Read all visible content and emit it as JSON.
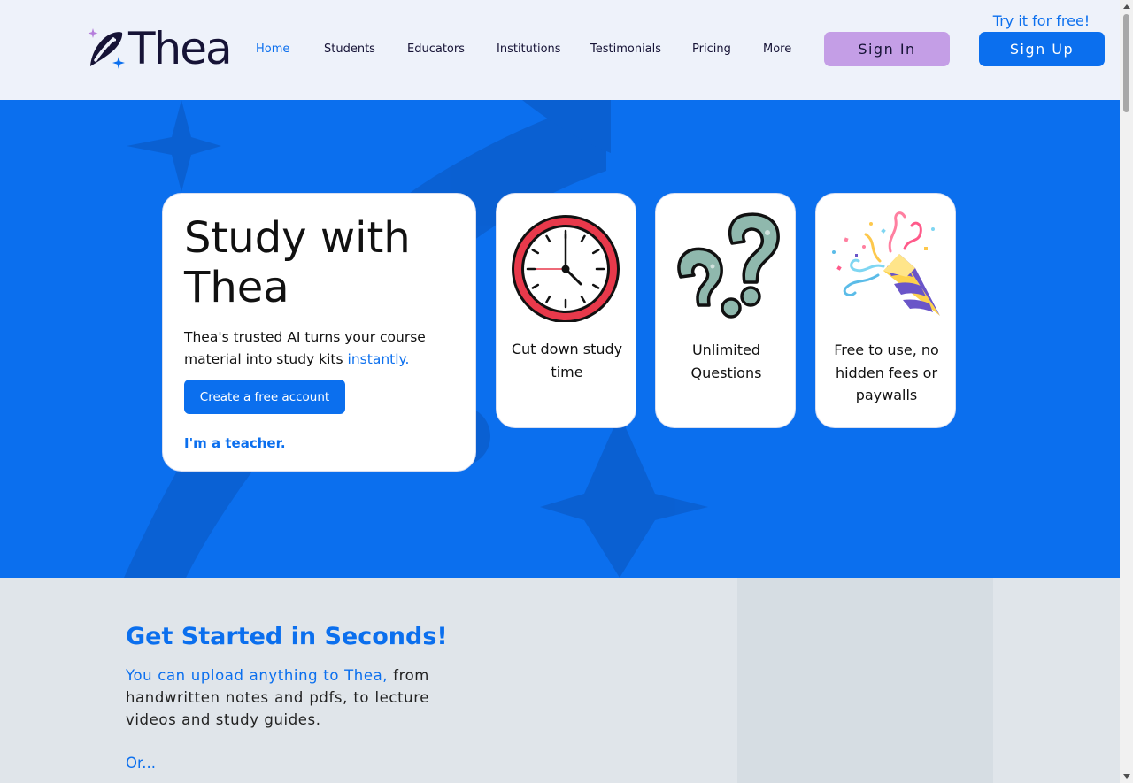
{
  "header": {
    "logo_text": "Thea",
    "nav": [
      {
        "label": "Home",
        "active": true
      },
      {
        "label": "Students",
        "active": false
      },
      {
        "label": "Educators",
        "active": false
      },
      {
        "label": "Institutions",
        "active": false
      },
      {
        "label": "Testimonials",
        "active": false
      },
      {
        "label": "Pricing",
        "active": false
      },
      {
        "label": "More",
        "active": false
      }
    ],
    "sign_in_label": "Sign In",
    "try_free_label": "Try it for free!",
    "sign_up_label": "Sign Up"
  },
  "hero": {
    "title_line1": "Study with",
    "title_line2": "Thea",
    "description": "Thea's trusted AI turns your course material into study kits",
    "description_highlight": "instantly.",
    "create_account_label": "Create a free account",
    "teacher_link_label": "I'm a teacher.",
    "features": [
      {
        "icon": "clock-icon",
        "label": "Cut down study time"
      },
      {
        "icon": "question-marks-icon",
        "label": "Unlimited Questions"
      },
      {
        "icon": "party-popper-icon",
        "label": "Free to use, no hidden fees or paywalls"
      }
    ]
  },
  "get_started": {
    "title": "Get Started in Seconds!",
    "desc_highlight": "You can upload anything to Thea,",
    "desc_rest": " from handwritten notes and pdfs, to lecture videos and study guides.",
    "or_label": "Or..."
  },
  "colors": {
    "brand_blue": "#0b6fee",
    "sign_in_purple": "#c49ee6",
    "header_bg": "#eef2fa",
    "dark_navy": "#161336"
  }
}
